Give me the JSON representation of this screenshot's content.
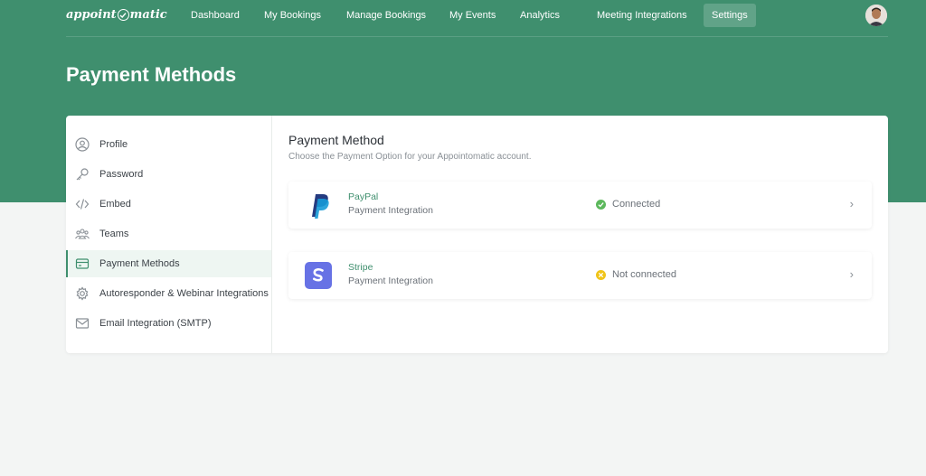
{
  "brand": {
    "logo_before": "appoint",
    "logo_after": "matic",
    "accent": "#3f8f6e"
  },
  "nav": {
    "items": [
      {
        "label": "Dashboard"
      },
      {
        "label": "My Bookings"
      },
      {
        "label": "Manage Bookings"
      },
      {
        "label": "My Events"
      },
      {
        "label": "Analytics"
      },
      {
        "label": "Meeting Integrations"
      },
      {
        "label": "Settings",
        "active": true
      }
    ]
  },
  "page": {
    "title": "Payment Methods"
  },
  "sidebar": {
    "items": [
      {
        "label": "Profile",
        "icon": "user-circle-icon"
      },
      {
        "label": "Password",
        "icon": "key-icon"
      },
      {
        "label": "Embed",
        "icon": "code-icon"
      },
      {
        "label": "Teams",
        "icon": "team-icon"
      },
      {
        "label": "Payment Methods",
        "icon": "credit-card-icon",
        "active": true
      },
      {
        "label": "Autoresponder & Webinar Integrations",
        "icon": "gear-icon"
      },
      {
        "label": "Email Integration (SMTP)",
        "icon": "envelope-icon"
      }
    ]
  },
  "main": {
    "title": "Payment Method",
    "subtitle": "Choose the Payment Option for your Appointomatic account.",
    "methods": [
      {
        "name": "PayPal",
        "desc": "Payment Integration",
        "status": "Connected",
        "status_color": "#5cb85c",
        "icon": "paypal-logo-icon"
      },
      {
        "name": "Stripe",
        "desc": "Payment Integration",
        "status": "Not connected",
        "status_color": "#f0c419",
        "icon": "stripe-logo-icon"
      }
    ]
  }
}
